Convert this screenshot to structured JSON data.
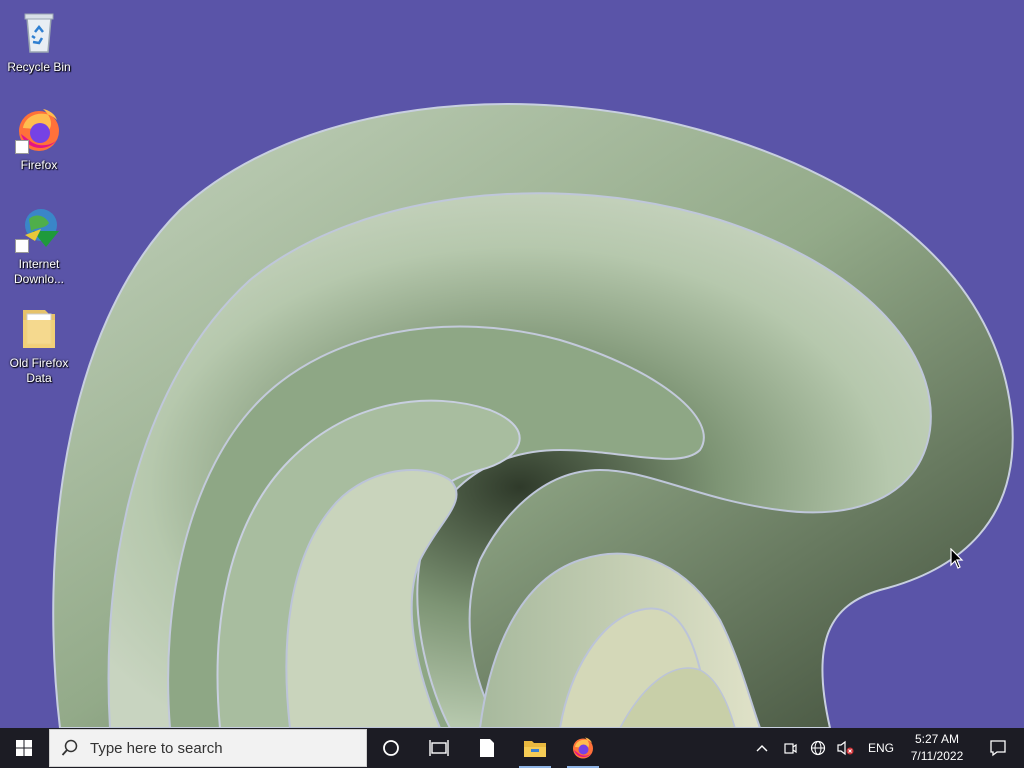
{
  "desktop": {
    "background_color": "#5a54a8",
    "icons": [
      {
        "label": "Recycle Bin",
        "icon": "recycle-bin-icon"
      },
      {
        "label": "Firefox",
        "icon": "firefox-icon"
      },
      {
        "label": "Internet Downlo...",
        "icon": "internet-download-manager-icon"
      },
      {
        "label": "Old Firefox Data",
        "icon": "folder-icon"
      }
    ]
  },
  "taskbar": {
    "background_color": "#1c1c24",
    "start_icon": "windows-logo-icon",
    "search": {
      "placeholder": "Type here to search",
      "icon": "search-icon"
    },
    "pinned": [
      {
        "name": "cortana",
        "icon": "cortana-circle-icon"
      },
      {
        "name": "task-view",
        "icon": "task-view-icon"
      },
      {
        "name": "notepad",
        "icon": "blank-document-icon"
      },
      {
        "name": "file-explorer",
        "icon": "folder-icon"
      },
      {
        "name": "firefox",
        "icon": "firefox-icon"
      }
    ],
    "tray": {
      "chevron_icon": "chevron-up-icon",
      "meet_icon": "meet-now-icon",
      "network_icon": "globe-network-icon",
      "volume_icon": "volume-muted-icon",
      "language": "ENG",
      "time": "5:27 AM",
      "date": "7/11/2022",
      "notification_icon": "action-center-icon"
    }
  }
}
